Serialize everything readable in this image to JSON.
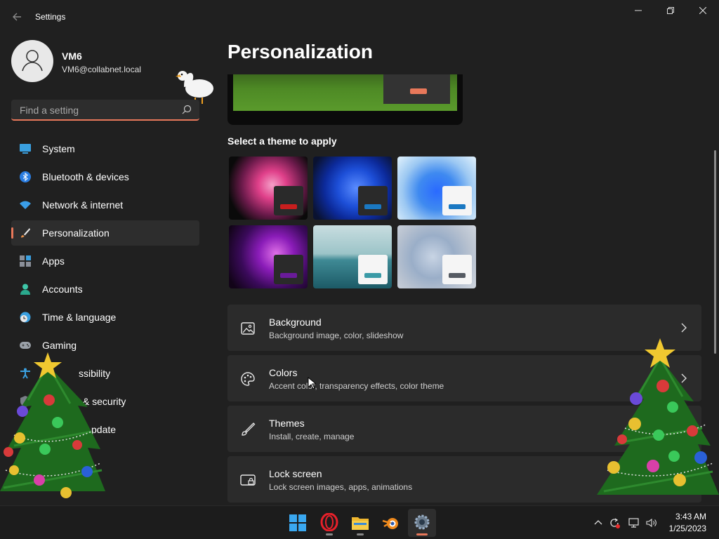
{
  "window": {
    "title": "Settings",
    "back_icon": "back-arrow-icon",
    "controls": [
      "minimize",
      "restore",
      "close"
    ]
  },
  "user": {
    "name": "VM6",
    "email": "VM6@collabnet.local"
  },
  "search": {
    "placeholder": "Find a setting"
  },
  "sidebar": {
    "items": [
      {
        "label": "System",
        "icon": "system-icon"
      },
      {
        "label": "Bluetooth & devices",
        "icon": "bluetooth-icon"
      },
      {
        "label": "Network & internet",
        "icon": "wifi-icon"
      },
      {
        "label": "Personalization",
        "icon": "brush-icon",
        "active": true
      },
      {
        "label": "Apps",
        "icon": "apps-icon"
      },
      {
        "label": "Accounts",
        "icon": "accounts-icon"
      },
      {
        "label": "Time & language",
        "icon": "clock-globe-icon"
      },
      {
        "label": "Gaming",
        "icon": "gamepad-icon"
      },
      {
        "label": "ssibility",
        "icon": "accessibility-icon"
      },
      {
        "label": "y & security",
        "icon": "shield-icon"
      },
      {
        "label": "pdate",
        "icon": "update-icon"
      }
    ]
  },
  "main": {
    "title": "Personalization",
    "themes_label": "Select a theme to apply",
    "themes": [
      {
        "name": "glow-dark",
        "accent": "#c81e1e"
      },
      {
        "name": "bloom-dark",
        "accent": "#1a78c2"
      },
      {
        "name": "bloom-light",
        "accent": "#1a78c2"
      },
      {
        "name": "glow-purple",
        "accent": "#6a1b9a"
      },
      {
        "name": "lake",
        "accent": "#3a9aa6"
      },
      {
        "name": "flow",
        "accent": "#555a62"
      }
    ],
    "cards": [
      {
        "title": "Background",
        "subtitle": "Background image, color, slideshow",
        "icon": "image-icon"
      },
      {
        "title": "Colors",
        "subtitle": "Accent color, transparency effects, color theme",
        "icon": "palette-icon"
      },
      {
        "title": "Themes",
        "subtitle": "Install, create, manage",
        "icon": "brush-icon"
      },
      {
        "title": "Lock screen",
        "subtitle": "Lock screen images, apps, animations",
        "icon": "lock-screen-icon"
      }
    ]
  },
  "taskbar": {
    "apps": [
      "windows-start-icon",
      "opera-icon",
      "file-explorer-icon",
      "blender-icon",
      "settings-icon"
    ],
    "tray": [
      "chevron-up-icon",
      "sync-icon",
      "network-icon",
      "volume-icon"
    ],
    "time": "3:43 AM",
    "date": "1/25/2023"
  },
  "colors": {
    "accent": "#e8785a",
    "background": "#202020",
    "card": "#2b2b2b"
  }
}
